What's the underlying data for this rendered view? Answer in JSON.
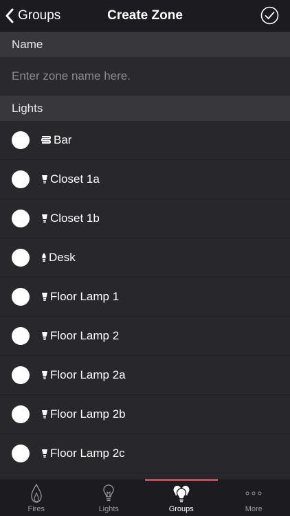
{
  "navbar": {
    "back_label": "Groups",
    "title": "Create Zone"
  },
  "name_section": {
    "header": "Name",
    "placeholder": "Enter zone name here.",
    "value": ""
  },
  "lights_section": {
    "header": "Lights",
    "items": [
      {
        "label": "Bar",
        "icon": "lightstrip-icon"
      },
      {
        "label": "Closet 1a",
        "icon": "spot-bulb-icon"
      },
      {
        "label": "Closet 1b",
        "icon": "spot-bulb-icon"
      },
      {
        "label": "Desk",
        "icon": "candle-bulb-icon"
      },
      {
        "label": "Floor Lamp 1",
        "icon": "spot-bulb-icon"
      },
      {
        "label": "Floor Lamp 2",
        "icon": "spot-bulb-icon"
      },
      {
        "label": "Floor Lamp 2a",
        "icon": "spot-bulb-icon"
      },
      {
        "label": "Floor Lamp 2b",
        "icon": "spot-bulb-icon"
      },
      {
        "label": "Floor Lamp 2c",
        "icon": "spot-bulb-icon"
      }
    ]
  },
  "tabbar": {
    "tabs": [
      {
        "label": "Fires",
        "icon": "flame-icon"
      },
      {
        "label": "Lights",
        "icon": "bulb-icon"
      },
      {
        "label": "Groups",
        "icon": "bulb-group-icon"
      },
      {
        "label": "More",
        "icon": "more-dots-icon"
      }
    ],
    "active_tab": "Groups"
  },
  "colors": {
    "background": "#28272c",
    "section_header": "#38373c",
    "bar": "#1c1b1f",
    "accent": "#e0434f",
    "text": "#ffffff",
    "placeholder": "#8b8a90"
  }
}
